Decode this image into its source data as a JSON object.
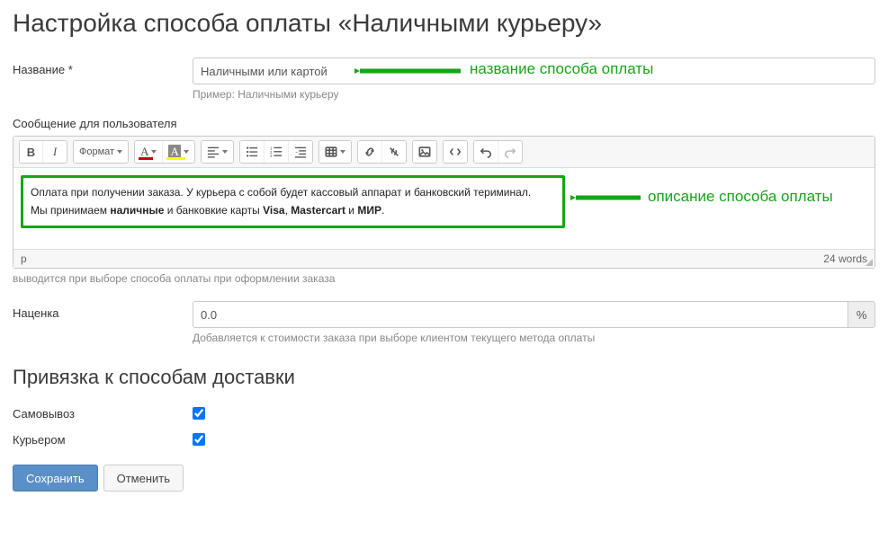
{
  "page_title": "Настройка способа оплаты «Наличными курьеру»",
  "name_field": {
    "label": "Название *",
    "value": "Наличными или картой",
    "hint": "Пример: Наличными курьеру"
  },
  "message_section": {
    "label": "Сообщение для пользователя",
    "hint": "выводится при выборе способа оплаты при оформлении заказа"
  },
  "toolbar": {
    "bold": "B",
    "italic": "I",
    "format": "Формат",
    "a": "A"
  },
  "editor": {
    "line1_pre": "Оплата при получении заказа. У курьера с собой будет кассовый аппарат и банковский териминал.",
    "line2_a": "Мы принимаем ",
    "line2_b": "наличные",
    "line2_c": " и банковкие карты ",
    "line2_d": "Visa",
    "line2_e": ", ",
    "line2_f": "Mastercart",
    "line2_g": " и ",
    "line2_h": "МИР",
    "line2_i": ".",
    "status_path": "p",
    "status_words": "24 words"
  },
  "markup": {
    "label": "Наценка",
    "value": "0.0",
    "addon": "%",
    "hint": "Добавляется к стоимости заказа при выборе клиентом текущего метода оплаты"
  },
  "delivery_section": {
    "heading": "Привязка к способам доставки",
    "option1": "Самовывоз",
    "option2": "Курьером"
  },
  "buttons": {
    "save": "Сохранить",
    "cancel": "Отменить"
  },
  "annotations": {
    "name": "название способа оплаты",
    "desc": "описание способа оплаты"
  }
}
